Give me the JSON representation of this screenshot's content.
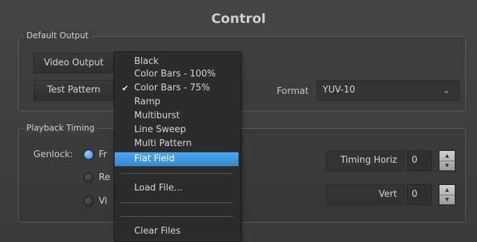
{
  "window": {
    "title": "Control"
  },
  "default_output": {
    "group_label": "Default Output",
    "video_output_label": "Video Output",
    "test_pattern_label": "Test Pattern",
    "format_label": "Format",
    "format_value": "YUV-10"
  },
  "playback_timing": {
    "group_label": "Playback Timing",
    "genlock_label": "Genlock:",
    "radio_1_partial": "Fr",
    "radio_2_partial": "Re",
    "radio_3_partial": "Vi",
    "timing_horiz_label": "Timing Horiz",
    "timing_horiz_value": "0",
    "vert_label": "Vert",
    "vert_value": "0"
  },
  "test_pattern_menu": {
    "items": [
      {
        "label": "Black",
        "checked": false,
        "selected": false
      },
      {
        "label": "Color Bars - 100%",
        "checked": false,
        "selected": false
      },
      {
        "label": "Color Bars - 75%",
        "checked": true,
        "selected": false
      },
      {
        "label": "Ramp",
        "checked": false,
        "selected": false
      },
      {
        "label": "Multiburst",
        "checked": false,
        "selected": false
      },
      {
        "label": "Line Sweep",
        "checked": false,
        "selected": false
      },
      {
        "label": "Multi Pattern",
        "checked": false,
        "selected": false
      },
      {
        "label": "Flat Field",
        "checked": false,
        "selected": true
      }
    ],
    "load_file_label": "Load File...",
    "clear_files_label": "Clear Files"
  },
  "icons": {
    "check": "checkmark-icon",
    "dropdown": "chevron-down-icon",
    "stepper_up": "triangle-up-icon",
    "stepper_down": "triangle-down-icon"
  },
  "colors": {
    "highlight": "#3a93dc",
    "radio_selected": "#2a79c9"
  }
}
